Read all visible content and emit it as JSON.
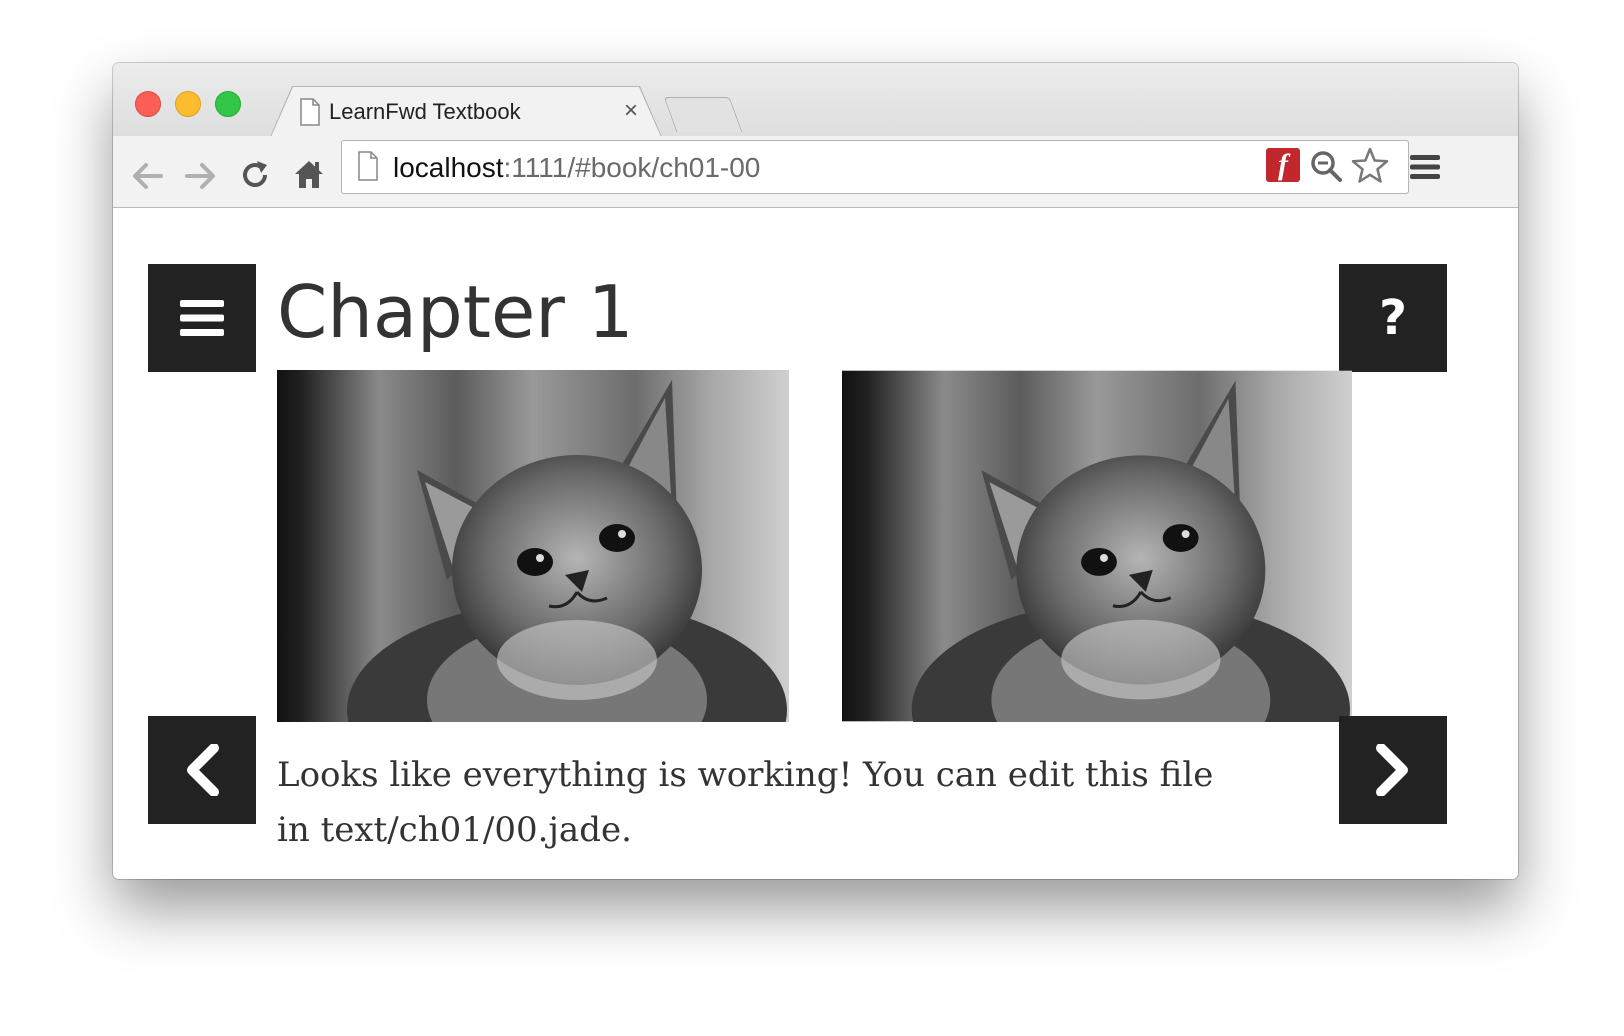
{
  "browser": {
    "tab_title": "LearnFwd Textbook",
    "tab_close": "×",
    "url_host": "localhost",
    "url_path": ":1111/#book/ch01-00",
    "toolbar_icons": [
      "back-arrow-icon",
      "forward-arrow-icon",
      "reload-icon",
      "home-icon",
      "flash-icon",
      "zoom-icon",
      "bookmark-star-icon",
      "menu-icon"
    ]
  },
  "page": {
    "title": "Chapter 1",
    "help_label": "?",
    "body_text": "Looks like everything is working! You can edit this file in text/ch01/00.jade.",
    "images": [
      "kitten",
      "kitten"
    ]
  },
  "colors": {
    "button_bg": "#222222",
    "text": "#333333",
    "traffic_red": "#fc5f57",
    "traffic_yellow": "#fdbc2e",
    "traffic_green": "#33c748",
    "flash_red": "#c1272d"
  }
}
